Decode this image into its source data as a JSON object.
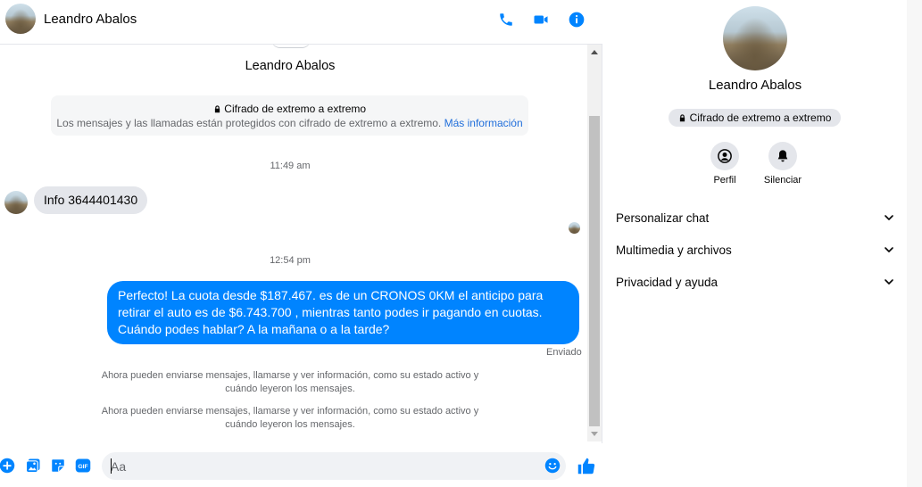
{
  "header": {
    "name": "Leandro Abalos",
    "icons": [
      "phone-icon",
      "video-camera-icon",
      "info-icon"
    ]
  },
  "conversation": {
    "peer_name": "Leandro Abalos",
    "e2e_title": "Cifrado de extremo a extremo",
    "e2e_subtitle": "Los mensajes y las llamadas están protegidos con cifrado de extremo a extremo.",
    "e2e_link": "Más información",
    "time_1": "11:49 am",
    "incoming_message": "Info 3644401430",
    "time_2": "12:54 pm",
    "outgoing_message": "Perfecto! La cuota desde $187.467. es de un CRONOS 0KM el anticipo para retirar el auto es de $6.743.700 , mientras tanto podes ir pagando en cuotas. Cuándo podes hablar? A la mañana o a la tarde?",
    "sent_status": "Enviado",
    "system_message_1": "Ahora pueden enviarse mensajes, llamarse y ver información, como su estado activo y cuándo leyeron los mensajes.",
    "system_message_2": "Ahora pueden enviarse mensajes, llamarse y ver información, como su estado activo y cuándo leyeron los mensajes."
  },
  "composer": {
    "placeholder": "Aa",
    "icons": [
      "plus-icon",
      "image-icon",
      "sticker-icon",
      "gif-icon",
      "emoji-icon",
      "thumbs-up-icon"
    ],
    "gif_label": "GIF"
  },
  "info_panel": {
    "name": "Leandro Abalos",
    "encryption_label": "Cifrado de extremo a extremo",
    "actions": [
      {
        "label": "Perfil"
      },
      {
        "label": "Silenciar"
      }
    ],
    "menu": [
      {
        "label": "Personalizar chat"
      },
      {
        "label": "Multimedia y archivos"
      },
      {
        "label": "Privacidad y ayuda"
      }
    ]
  },
  "colors": {
    "accent": "#0084ff",
    "bubble_in": "#e4e6eb",
    "link": "#216fdb",
    "muted_text": "#65676b"
  }
}
